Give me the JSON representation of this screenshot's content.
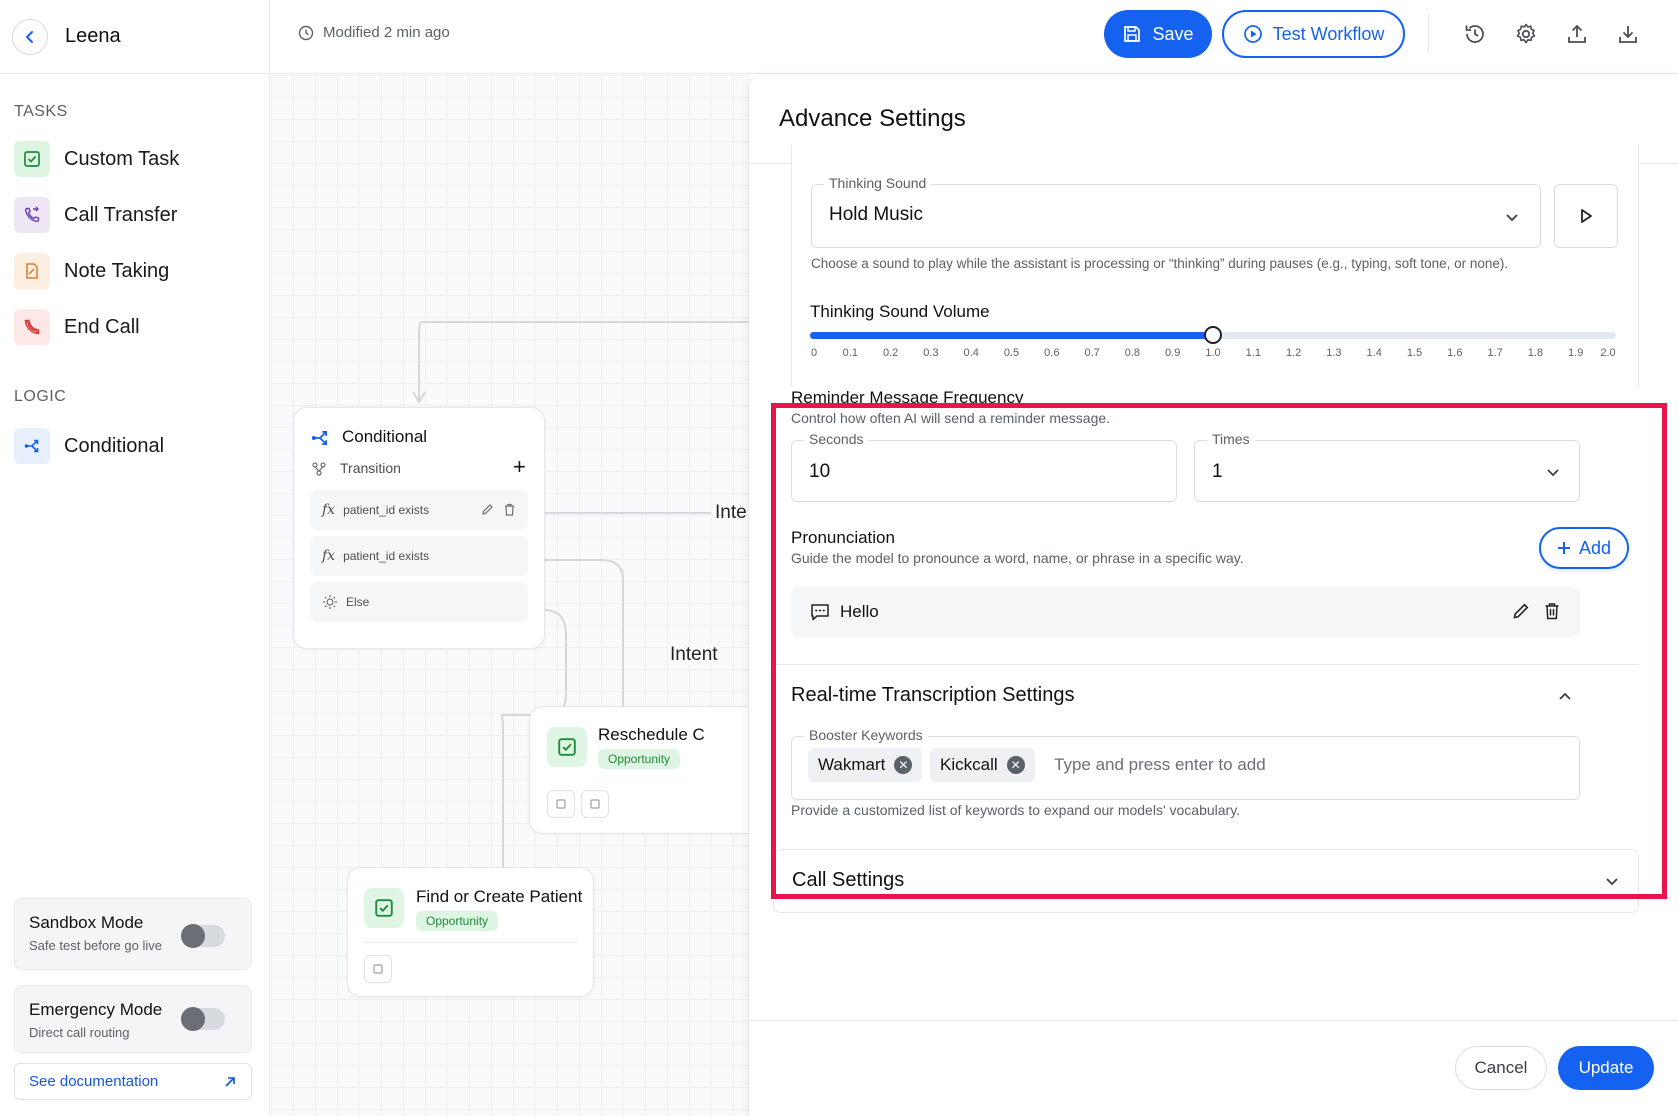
{
  "sidebar": {
    "title": "Leena",
    "tasks_heading": "TASKS",
    "tasks": [
      {
        "label": "Custom Task",
        "icon": "checkbox-icon",
        "bg": "#dff5e3",
        "color": "#1f8a3a"
      },
      {
        "label": "Call Transfer",
        "icon": "phone-transfer-icon",
        "bg": "#ede7f6",
        "color": "#6b3fb8"
      },
      {
        "label": "Note Taking",
        "icon": "note-icon",
        "bg": "#fdeee2",
        "color": "#e07a2e"
      },
      {
        "label": "End Call",
        "icon": "end-call-icon",
        "bg": "#fde7e7",
        "color": "#d93838"
      }
    ],
    "logic_heading": "LOGIC",
    "logic": [
      {
        "label": "Conditional",
        "icon": "branch-icon",
        "bg": "#e8f0fd",
        "color": "#1662f0"
      }
    ],
    "sandbox": {
      "title": "Sandbox Mode",
      "subtitle": "Safe test before go live",
      "enabled": false
    },
    "emergency": {
      "title": "Emergency Mode",
      "subtitle": "Direct call routing",
      "enabled": false
    },
    "doc_link": "See documentation"
  },
  "topbar": {
    "modified": "Modified 2 min ago",
    "save": "Save",
    "test": "Test Workflow",
    "icons": [
      "history-icon",
      "gear-icon",
      "upload-icon",
      "download-icon"
    ]
  },
  "canvas": {
    "conditional_node": {
      "title": "Conditional",
      "transition": "Transition",
      "rows": [
        "patient_id exists",
        "patient_id exists",
        "Else"
      ]
    },
    "edge_labels": [
      "Inte",
      "Intent"
    ],
    "reschedule_node": {
      "title": "Reschedule C",
      "badge": "Opportunity"
    },
    "find_node": {
      "title": "Find or Create Patient",
      "badge": "Opportunity"
    }
  },
  "panel": {
    "title": "Advance Settings",
    "thinking_sound": {
      "label": "Thinking Sound",
      "value": "Hold Music",
      "hint": "Choose a sound to play while the assistant is processing or “thinking” during pauses (e.g., typing, soft tone, or none)."
    },
    "volume": {
      "label": "Thinking Sound Volume",
      "value": 1.0,
      "min": 0,
      "max": 2.0,
      "ticks": [
        "0",
        "0.1",
        "0.2",
        "0.3",
        "0.4",
        "0.5",
        "0.6",
        "0.7",
        "0.8",
        "0.9",
        "1.0",
        "1.1",
        "1.2",
        "1.3",
        "1.4",
        "1.5",
        "1.6",
        "1.7",
        "1.8",
        "1.9",
        "2.0"
      ]
    },
    "reminder": {
      "title": "Reminder Message Frequency",
      "hint": "Control how often AI will send a reminder message.",
      "seconds_label": "Seconds",
      "seconds_value": "10",
      "times_label": "Times",
      "times_value": "1"
    },
    "pronunciation": {
      "title": "Pronunciation",
      "hint": "Guide the model to pronounce a word, name, or phrase in a specific way.",
      "add": "Add",
      "items": [
        "Hello"
      ]
    },
    "transcription": {
      "title": "Real-time Transcription Settings",
      "booster_label": "Booster Keywords",
      "keywords": [
        "Wakmart",
        "Kickcall"
      ],
      "placeholder": "Type and press enter to add",
      "hint": "Provide a customized list of keywords to expand our models' vocabulary."
    },
    "call_settings": {
      "title": "Call Settings"
    },
    "cancel": "Cancel",
    "update": "Update"
  },
  "colors": {
    "accent": "#1662f0",
    "highlight": "#e8144c",
    "success": "#1f8a3a"
  }
}
